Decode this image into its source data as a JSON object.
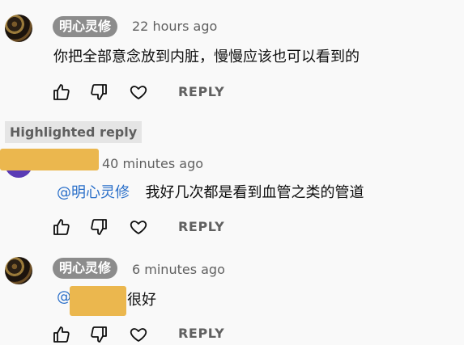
{
  "comments": [
    {
      "author": "明心灵修",
      "time": "22 hours ago",
      "text": "你把全部意念放到内脏，慢慢应该也可以看到的",
      "reply_label": "REPLY"
    },
    {
      "highlight_badge": "Highlighted reply",
      "time": "40 minutes ago",
      "mention": "@明心灵修",
      "text": "我好几次都是看到血管之类的管道",
      "reply_label": "REPLY"
    },
    {
      "author": "明心灵修",
      "time": "6 minutes ago",
      "mention_prefix": "@",
      "text": "很好",
      "reply_label": "REPLY"
    }
  ],
  "icons": {
    "like": "thumbs-up-icon",
    "dislike": "thumbs-down-icon",
    "heart": "heart-icon"
  },
  "colors": {
    "background": "#f9f9f9",
    "name_pill": "#8c8c8c",
    "mention_link": "#2a6fc9",
    "redaction": "#ebb74e",
    "secondary_text": "#606060"
  }
}
